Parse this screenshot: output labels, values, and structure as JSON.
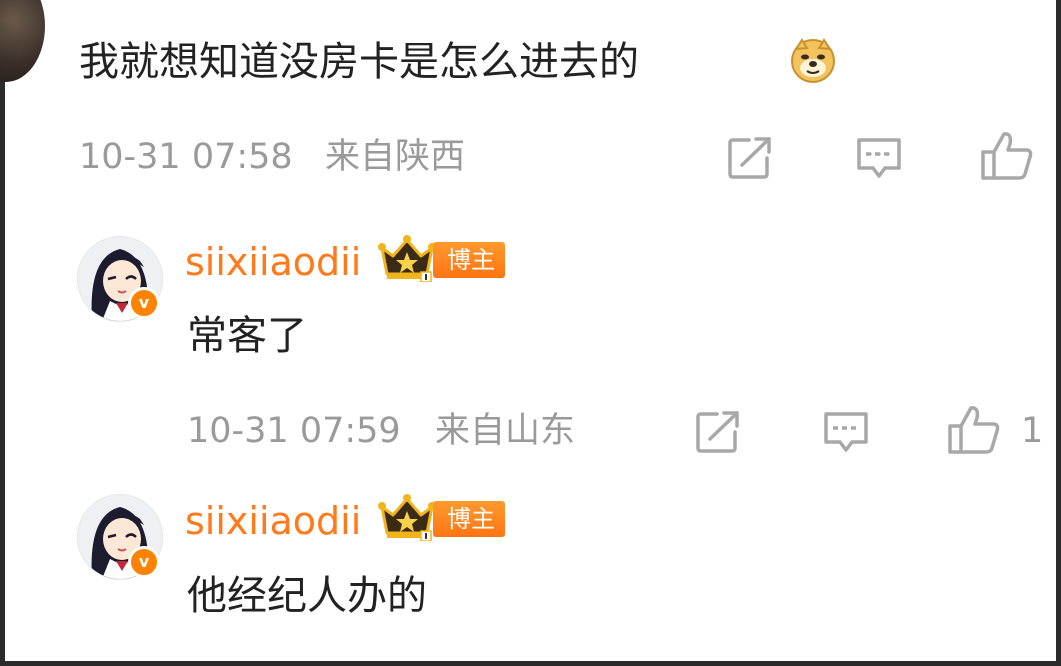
{
  "comment1": {
    "text": "我就想知道没房卡是怎么进去的",
    "emoji": "doge-emoji",
    "time": "10-31 07:58",
    "location": "来自陕西"
  },
  "reply1": {
    "username": "siixiiaodii",
    "tag": "博主",
    "text": "常客了",
    "time": "10-31 07:59",
    "location": "来自山东",
    "like_count": "1"
  },
  "reply2": {
    "username": "siixiiaodii",
    "tag": "博主",
    "text": "他经纪人办的"
  },
  "colors": {
    "username": "#ff7a1a",
    "tag": "#ff7414",
    "verified": "#ff8200",
    "meta": "#9a9a9a",
    "text": "#222222"
  }
}
